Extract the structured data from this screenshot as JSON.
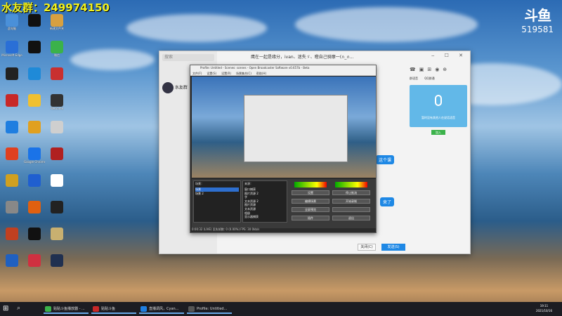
{
  "overlay": {
    "qq_group": "水友群：249974150"
  },
  "brand": {
    "logo": "斗鱼",
    "room_id": "519581"
  },
  "desktop_icons": [
    {
      "label": "此电脑",
      "color": "#4a90d9"
    },
    {
      "label": "",
      "color": "#111111"
    },
    {
      "label": "新建文件夹",
      "color": "#d8a040"
    },
    {
      "label": "Microsoft Edge",
      "color": "#2a6fd6"
    },
    {
      "label": "",
      "color": "#111111"
    },
    {
      "label": "微信",
      "color": "#3bb24a"
    },
    {
      "label": "",
      "color": "#222222"
    },
    {
      "label": "",
      "color": "#1f8ad8"
    },
    {
      "label": "",
      "color": "#c83030"
    },
    {
      "label": "",
      "color": "#c82828"
    },
    {
      "label": "",
      "color": "#f0c030"
    },
    {
      "label": "WeGame",
      "color": "#333333"
    },
    {
      "label": "",
      "color": "#1f7ee0"
    },
    {
      "label": "",
      "color": "#e0a020"
    },
    {
      "label": "",
      "color": "#cfcfcf"
    },
    {
      "label": "",
      "color": "#e04020"
    },
    {
      "label": "Google Chrome",
      "color": "#1a73e8"
    },
    {
      "label": "",
      "color": "#b02020"
    },
    {
      "label": "",
      "color": "#d0a020"
    },
    {
      "label": "",
      "color": "#1f5fd0"
    },
    {
      "label": "",
      "color": "#ffffff"
    },
    {
      "label": "",
      "color": "#888888"
    },
    {
      "label": "",
      "color": "#e06010"
    },
    {
      "label": "",
      "color": "#222222"
    },
    {
      "label": "",
      "color": "#c04020"
    },
    {
      "label": "",
      "color": "#111111"
    },
    {
      "label": "",
      "color": "#c8b070"
    },
    {
      "label": "",
      "color": "#2060c0"
    },
    {
      "label": "",
      "color": "#d03040"
    },
    {
      "label": "",
      "color": "#203050"
    }
  ],
  "chat": {
    "search_placeholder": "搜索",
    "title": "鹰在一起是缘分，ivan、迷失ゞ、瞪自己骑摩一(∩_∩...",
    "contact_name": "水友群",
    "messages": [
      "这个课",
      "来了"
    ],
    "right_tabs": [
      "群语音",
      "QQ群通"
    ],
    "voice_text": "暂时没有其他人在说话语音",
    "join_label": "加入",
    "close_label": "关闭(C)",
    "send_label": "发送(S)"
  },
  "obs": {
    "title": "Profile: Untitled - Scenes: scenes - Open Broadcaster Software v0.657b - Beta",
    "menus": [
      "文件(F)",
      "设置(S)",
      "设置(R)",
      "场景集合(C)",
      "帮助(H)"
    ],
    "scenes_label": "场景：",
    "scenes": [
      "场景",
      "场景 2"
    ],
    "sources_label": "来源：",
    "sources": [
      "窗口捕获",
      "图片资源 2",
      "字",
      "文本资源 2",
      "图片资源",
      "文本资源",
      "相册",
      "显示器捕获"
    ],
    "controls": [
      "设置",
      "停止推流",
      "编辑场景",
      "开始录制",
      "全屏预览",
      "",
      "插件",
      "退出"
    ],
    "status": "0:00:32 (LIVE)   丢失帧数: 0 (0.00%)   FPS: 30   0kb/s"
  },
  "taskbar": {
    "items": [
      {
        "label": "贴贴斗鱼播放器 - ...",
        "color": "#3bb24a"
      },
      {
        "label": "贴贴斗鱼",
        "color": "#c82828"
      },
      {
        "label": "直播调风，Cyan...",
        "color": "#1f7ee0"
      },
      {
        "label": "Profile: Untitled...",
        "color": "#555555"
      }
    ],
    "time": "19:11",
    "date": "2021/10/16"
  }
}
